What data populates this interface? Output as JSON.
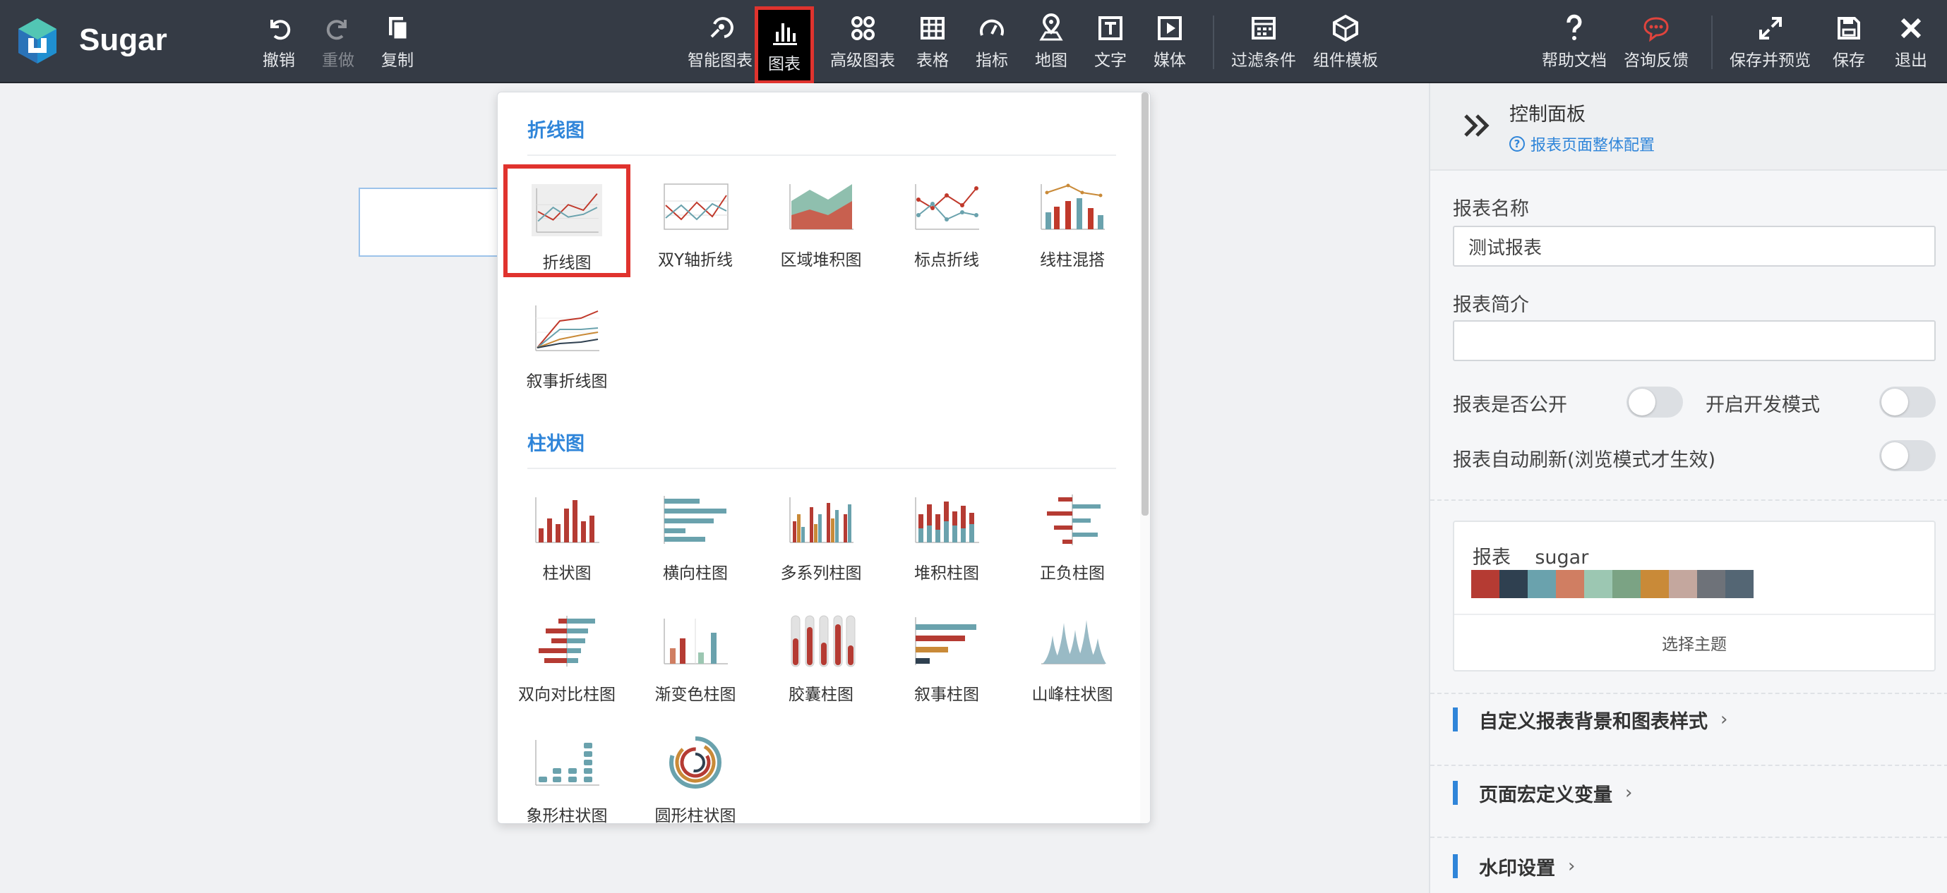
{
  "app": {
    "name": "Sugar"
  },
  "toolbar": {
    "undo": "撤销",
    "redo": "重做",
    "copy": "复制",
    "smart_chart": "智能图表",
    "chart": "图表",
    "advanced_chart": "高级图表",
    "table": "表格",
    "indicator": "指标",
    "map": "地图",
    "text": "文字",
    "media": "媒体",
    "filter": "过滤条件",
    "component_template": "组件模板",
    "help_docs": "帮助文档",
    "feedback": "咨询反馈",
    "save_preview": "保存并预览",
    "save": "保存",
    "exit": "退出"
  },
  "chart_picker": {
    "line_section": "折线图",
    "line_items": [
      "折线图",
      "双Y轴折线",
      "区域堆积图",
      "标点折线",
      "线柱混搭",
      "叙事折线图"
    ],
    "bar_section": "柱状图",
    "bar_items": [
      "柱状图",
      "横向柱图",
      "多系列柱图",
      "堆积柱图",
      "正负柱图",
      "双向对比柱图",
      "渐变色柱图",
      "胶囊柱图",
      "叙事柱图",
      "山峰柱状图",
      "象形柱状图",
      "圆形柱状图"
    ]
  },
  "panel": {
    "title": "控制面板",
    "page_config_link": "报表页面整体配置",
    "name_label": "报表名称",
    "name_value": "测试报表",
    "desc_label": "报表简介",
    "desc_value": "",
    "public_label": "报表是否公开",
    "dev_mode_label": "开启开发模式",
    "auto_refresh_label": "报表自动刷新(浏览模式才生效)",
    "theme_name": "报表    sugar",
    "theme_colors": [
      "#b53b33",
      "#2f4050",
      "#6aa2ad",
      "#d07e62",
      "#9cc7b2",
      "#7ba384",
      "#c98a38",
      "#c4a79e",
      "#6e7279",
      "#546674"
    ],
    "choose_theme": "选择主题",
    "custom_bg": "自定义报表背景和图表样式",
    "macro_vars": "页面宏定义变量",
    "watermark": "水印设置"
  }
}
